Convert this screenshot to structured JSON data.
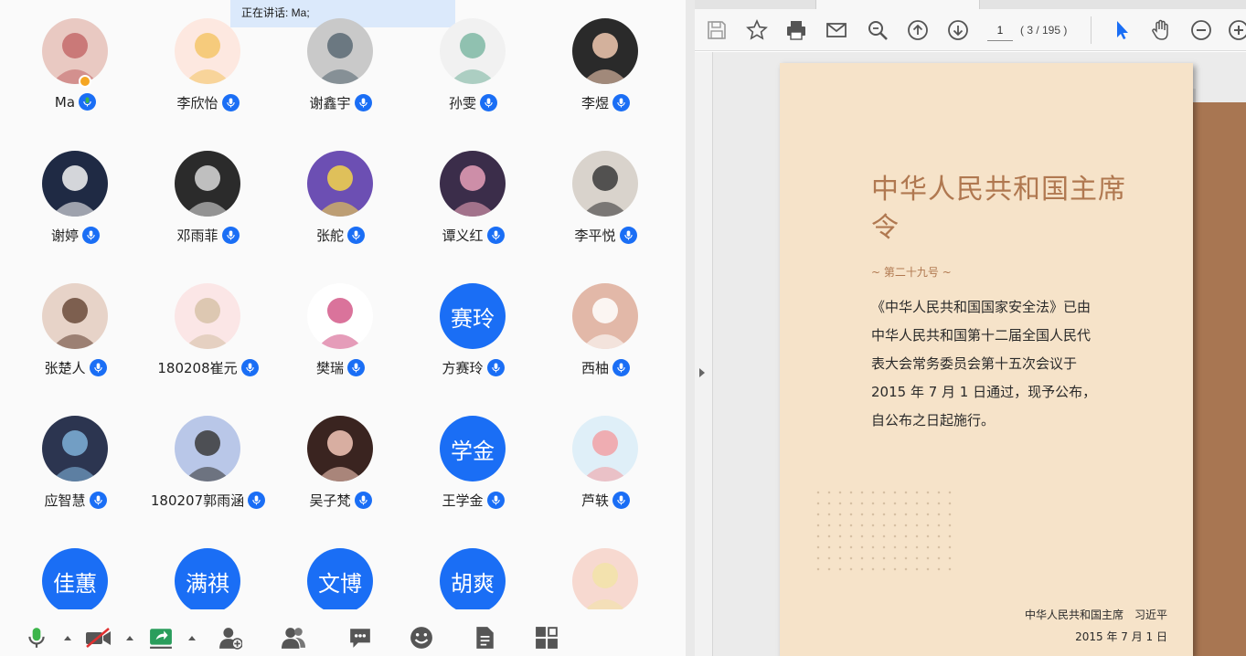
{
  "meeting": {
    "speaking_label": "正在讲话: Ma;",
    "participants": [
      {
        "name": "Ma",
        "avatar_text": "",
        "host": true
      },
      {
        "name": "李欣怡",
        "avatar_text": ""
      },
      {
        "name": "谢鑫宇",
        "avatar_text": ""
      },
      {
        "name": "孙雯",
        "avatar_text": ""
      },
      {
        "name": "李煜",
        "avatar_text": ""
      },
      {
        "name": "谢婷",
        "avatar_text": ""
      },
      {
        "name": "邓雨菲",
        "avatar_text": ""
      },
      {
        "name": "张舵",
        "avatar_text": ""
      },
      {
        "name": "谭义红",
        "avatar_text": ""
      },
      {
        "name": "李平悦",
        "avatar_text": ""
      },
      {
        "name": "张楚人",
        "avatar_text": ""
      },
      {
        "name": "180208崔元",
        "avatar_text": ""
      },
      {
        "name": "樊瑞",
        "avatar_text": ""
      },
      {
        "name": "方赛玲",
        "avatar_text": "赛玲"
      },
      {
        "name": "西柚",
        "avatar_text": ""
      },
      {
        "name": "应智慧",
        "avatar_text": ""
      },
      {
        "name": "180207郭雨涵",
        "avatar_text": ""
      },
      {
        "name": "吴子梵",
        "avatar_text": ""
      },
      {
        "name": "王学金",
        "avatar_text": "学金"
      },
      {
        "name": "芦轶",
        "avatar_text": ""
      },
      {
        "name": "",
        "avatar_text": "佳蕙"
      },
      {
        "name": "",
        "avatar_text": "满祺"
      },
      {
        "name": "",
        "avatar_text": "文博"
      },
      {
        "name": "",
        "avatar_text": "胡爽"
      },
      {
        "name": "",
        "avatar_text": ""
      }
    ]
  },
  "colors": {
    "accent": "#1a6ef5",
    "speaking_bg": "#dbe9fb",
    "page_bg": "#f6e3c9",
    "title_color": "#b07850",
    "back_page": "#a87652",
    "mic_active": "#3cb54a"
  },
  "toolbar_icons": [
    "microphone-icon",
    "video-off-icon",
    "share-screen-icon",
    "invite-icon",
    "participants-icon",
    "chat-icon",
    "reaction-icon",
    "document-icon",
    "apps-icon"
  ],
  "pdf": {
    "tools": [
      "save-icon",
      "bookmark-star-icon",
      "print-icon",
      "email-icon",
      "zoom-search-icon",
      "page-up-icon",
      "page-down-icon",
      "select-cursor-icon",
      "hand-tool-icon",
      "zoom-out-icon",
      "zoom-in-icon"
    ],
    "page_input": "1",
    "page_count": "( 3 / 195 )",
    "document": {
      "title": "中华人民共和国主席令",
      "number": "~ 第二十九号 ~",
      "body": "《中华人民共和国国家安全法》已由中华人民共和国第十二届全国人民代表大会常务委员会第十五次会议于 2015 年 7 月 1 日通过，现予公布，自公布之日起施行。",
      "signature": "中华人民共和国主席　习近平",
      "date": "2015 年 7 月 1 日"
    }
  }
}
